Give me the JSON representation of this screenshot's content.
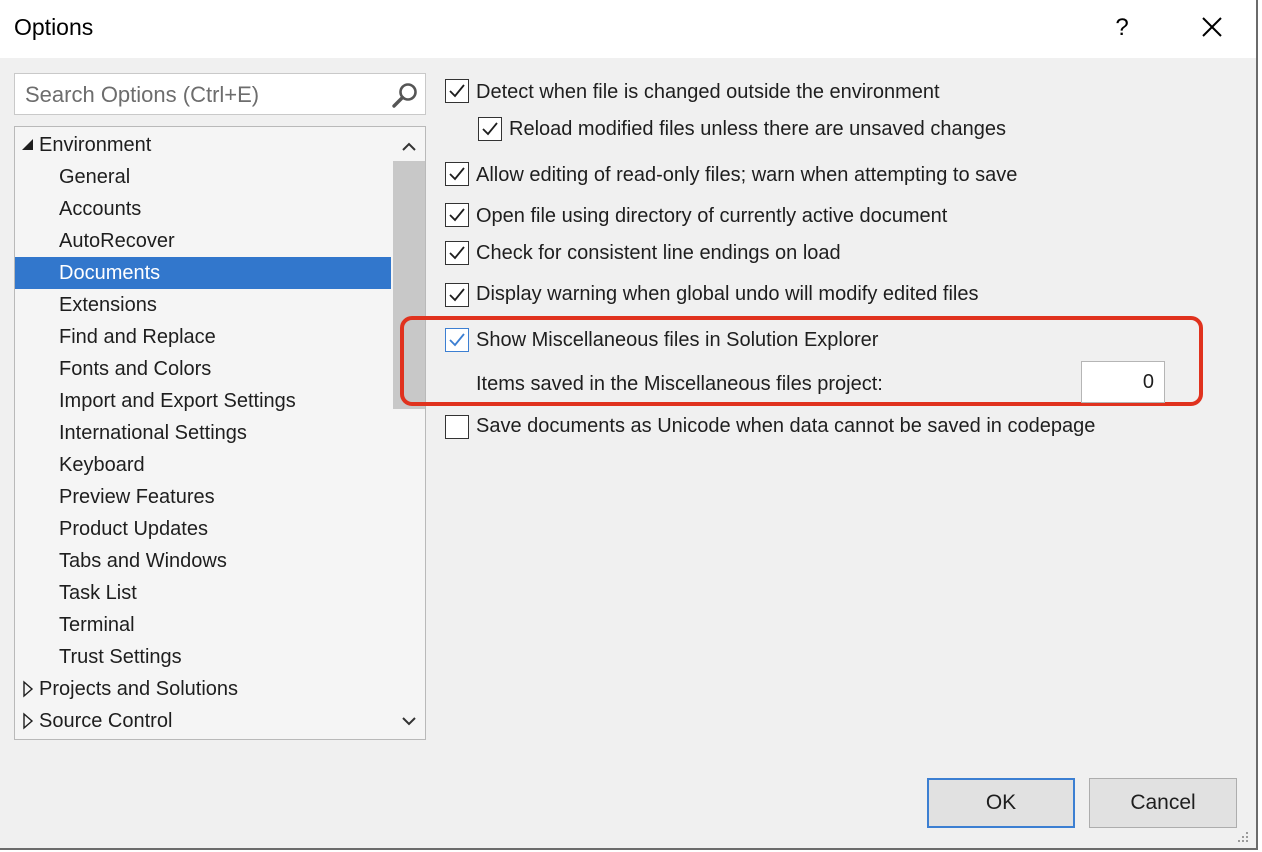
{
  "window": {
    "title": "Options",
    "help_label": "?"
  },
  "search": {
    "placeholder": "Search Options (Ctrl+E)"
  },
  "tree": {
    "environment_label": "Environment",
    "children": [
      "General",
      "Accounts",
      "AutoRecover",
      "Documents",
      "Extensions",
      "Find and Replace",
      "Fonts and Colors",
      "Import and Export Settings",
      "International Settings",
      "Keyboard",
      "Preview Features",
      "Product Updates",
      "Tabs and Windows",
      "Task List",
      "Terminal",
      "Trust Settings"
    ],
    "selected": "Documents",
    "collapsed_roots": [
      "Projects and Solutions",
      "Source Control"
    ]
  },
  "options": {
    "detect_changes": {
      "label": "Detect when file is changed outside the environment",
      "checked": true
    },
    "reload_modified": {
      "label": "Reload modified files unless there are unsaved changes",
      "checked": true
    },
    "allow_readonly": {
      "label": "Allow editing of read-only files; warn when attempting to save",
      "checked": true
    },
    "open_dir": {
      "label": "Open file using directory of currently active document",
      "checked": true
    },
    "line_endings": {
      "label": "Check for consistent line endings on load",
      "checked": true
    },
    "global_undo": {
      "label": "Display warning when global undo will modify edited files",
      "checked": true
    },
    "misc_files": {
      "label": "Show Miscellaneous files in Solution Explorer",
      "checked": true
    },
    "misc_items_label": "Items saved in the Miscellaneous files project:",
    "misc_items_value": "0",
    "save_unicode": {
      "label": "Save documents as Unicode when data cannot be saved in codepage",
      "checked": false
    }
  },
  "buttons": {
    "ok": "OK",
    "cancel": "Cancel"
  },
  "colors": {
    "accent": "#3277cc",
    "highlight_border": "#e0321e"
  }
}
